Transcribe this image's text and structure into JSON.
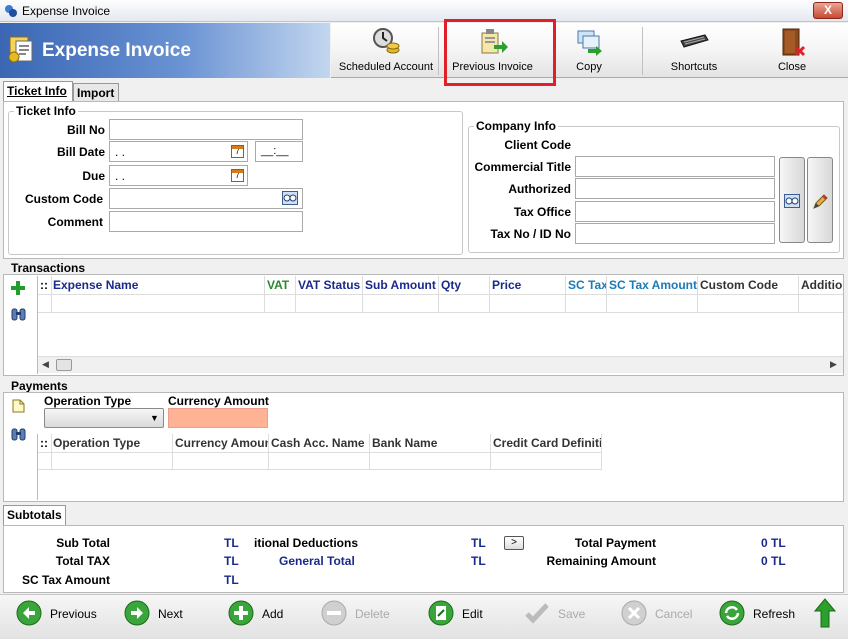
{
  "window": {
    "title": "Expense Invoice",
    "close_glyph": "X"
  },
  "header": {
    "title": "Expense Invoice"
  },
  "toolbar": {
    "scheduled": "Scheduled Account",
    "previous_invoice": "Previous Invoice",
    "copy": "Copy",
    "shortcuts": "Shortcuts",
    "close": "Close"
  },
  "tabs": {
    "ticket_info": "Ticket Info",
    "import": "Import"
  },
  "ticket": {
    "section": "Ticket Info",
    "bill_no_label": "Bill No",
    "bill_no": "",
    "bill_date_label": "Bill Date",
    "bill_date": ". .",
    "bill_time": "__:__",
    "due_label": "Due",
    "due": ". .",
    "custom_code_label": "Custom Code",
    "custom_code": "",
    "comment_label": "Comment",
    "comment": ""
  },
  "company": {
    "section": "Company Info",
    "client_code_label": "Client Code",
    "commercial_title_label": "Commercial Title",
    "authorized_label": "Authorized",
    "tax_office_label": "Tax Office",
    "tax_no_label": "Tax No / ID No"
  },
  "transactions": {
    "section": "Transactions",
    "columns": [
      "::",
      "Expense Name",
      "VAT",
      "VAT Status",
      "Sub Amount",
      "Qty",
      "Price",
      "SC Tax",
      "SC Tax Amount",
      "Custom Code",
      "Additio"
    ]
  },
  "payments": {
    "section": "Payments",
    "operation_type_label": "Operation Type",
    "operation_type": "",
    "currency_amount_label": "Currency Amount",
    "currency_amount": "",
    "columns": [
      "::",
      "Operation Type",
      "Currency Amoun",
      "Cash Acc. Name",
      "Bank Name",
      "Credit Card Definiti"
    ]
  },
  "subtotals": {
    "tab": "Subtotals",
    "sub_total_label": "Sub Total",
    "sub_total_cur": "TL",
    "total_tax_label": "Total TAX",
    "total_tax_cur": "TL",
    "sc_tax_label": "SC Tax Amount",
    "sc_tax_cur": "TL",
    "deductions_label": "itional Deductions",
    "deductions_cur": "TL",
    "general_total_label": "General Total",
    "general_total_cur": "TL",
    "expand_glyph": ">",
    "total_payment_label": "Total Payment",
    "total_payment": "0 TL",
    "remaining_label": "Remaining Amount",
    "remaining": "0 TL"
  },
  "bottom": {
    "previous": "Previous",
    "next": "Next",
    "add": "Add",
    "delete": "Delete",
    "edit": "Edit",
    "save": "Save",
    "cancel": "Cancel",
    "refresh": "Refresh"
  },
  "colors": {
    "accent_red": "#e0202a",
    "header_blue": "#3a66b4",
    "currency_fill": "#ffb394",
    "navy": "#1a2a8c"
  }
}
